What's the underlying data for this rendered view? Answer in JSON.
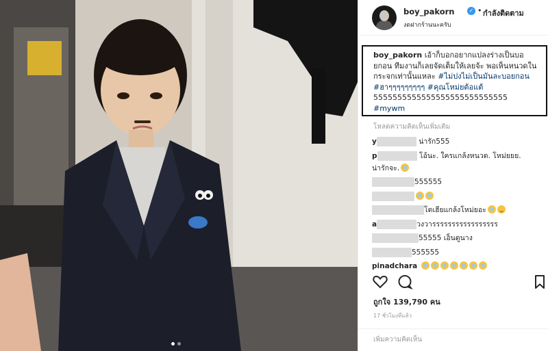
{
  "header": {
    "username": "boy_pakorn",
    "verified_mark": "✓",
    "separator": "•",
    "follow_status": "กำลังติดตาม",
    "location": "งดฝากร้านนะครับ"
  },
  "caption": {
    "username": "boy_pakorn",
    "text": " เอ้าก็บอกอยากแปลงร่างเป็นบอยกอน ทีมงานก็เลยจัดเต็มให้เลยจ้ะ พอเห็นหนวดในกระจกเท่านั้นแหละ ",
    "hashtag_1": "#ไม่ปงไม่เป็นมันละบอยกอน",
    "hashtag_2": "#ฮาๆๆๆๆๆๆๆๆๆ",
    "hashtag_3": "#คุณโหม่ยต้อแต้",
    "laugh": "5555555555555555555555555555",
    "hashtag_4": "#mywm"
  },
  "load_more": "โหลดความคิดเห็นเพิ่มเติม",
  "comments": [
    {
      "username": "y",
      "text": "น่ารัก555"
    },
    {
      "username": "p",
      "text": "โอ้นะ. ใครแกล้งหนวด. โหม่ยยย.",
      "continuation": "น่ารักจะ."
    },
    {
      "username": "",
      "text": "555555"
    },
    {
      "username": "",
      "text": ""
    },
    {
      "username": "",
      "text": "โดเฮียแกล้งโหม่ยอะ"
    },
    {
      "username": "a",
      "text": "วงวารรรรรรรรรรรรรรรรร"
    },
    {
      "username": "",
      "text": "55555 เอ็นดูนาง"
    },
    {
      "username": "",
      "text": "555555"
    },
    {
      "username": "pinadchara",
      "text": ""
    }
  ],
  "actions": {
    "like_icon": "heart-icon",
    "comment_icon": "comment-bubble-icon",
    "save_icon": "bookmark-icon"
  },
  "likes": "ถูกใจ 139,790 คน",
  "timestamp": "17 ชั่วโมงที่แล้ว",
  "add_comment": {
    "placeholder": "เพิ่มความคิดเห็น"
  },
  "colors": {
    "verified": "#3897f0",
    "hashtag": "#003569",
    "muted": "#999999",
    "text": "#262626",
    "highlight_border": "#111111"
  }
}
